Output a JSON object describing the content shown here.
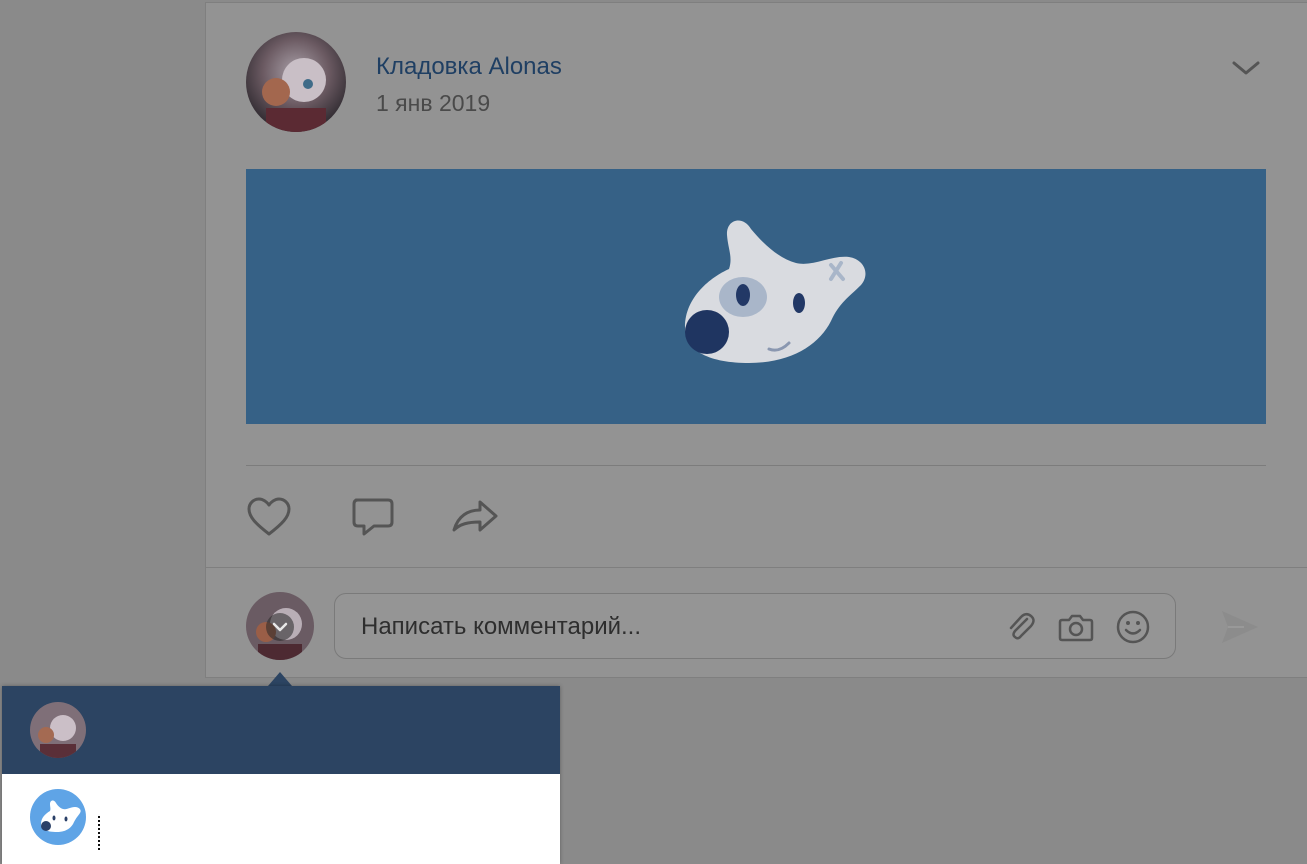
{
  "post": {
    "author": "Кладовка Alonas",
    "date": "1 янв 2019",
    "menu_icon": "chevron-down-icon",
    "image_icon": "vk-mascot-icon"
  },
  "actions": {
    "like_icon": "heart-icon",
    "comment_icon": "comment-icon",
    "share_icon": "share-icon"
  },
  "comment": {
    "placeholder": "Написать комментарий...",
    "attach_icon": "paperclip-icon",
    "camera_icon": "camera-icon",
    "emoji_icon": "smile-icon",
    "send_icon": "send-icon"
  },
  "colors": {
    "author_link": "#1f3f63",
    "image_background": "#366186",
    "dropdown_selected": "#2c4462",
    "dropdown_avatar_blue": "#5fa4e6"
  }
}
